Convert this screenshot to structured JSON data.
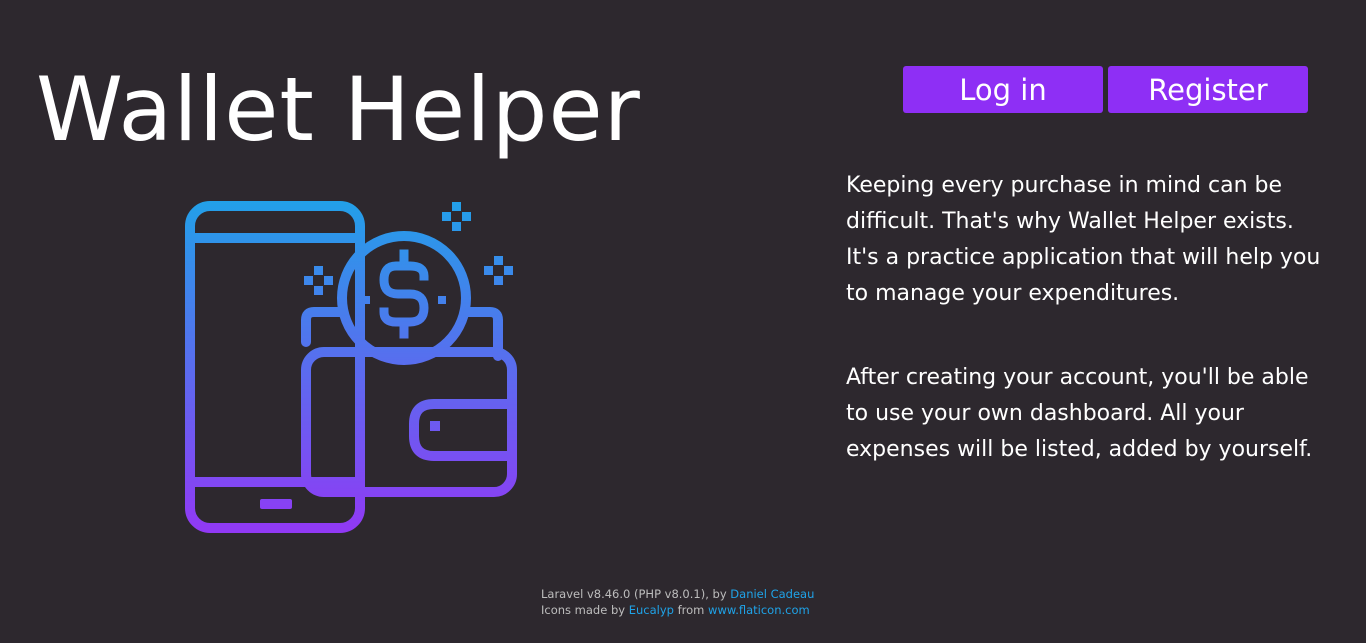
{
  "app": {
    "title": "Wallet Helper"
  },
  "nav": {
    "login_label": "Log in",
    "register_label": "Register"
  },
  "illustration": {
    "icon": "wallet-phone-dollar-icon",
    "gradient_top": "#1fa3e8",
    "gradient_bottom": "#9535f5"
  },
  "description": {
    "paragraph_1": "Keeping every purchase in mind can be difficult. That's why Wallet Helper exists. It's a practice application that will help you to manage your expenditures.",
    "paragraph_2": "After creating your account, you'll be able to use your own dashboard. All your expenses will be listed, added by yourself."
  },
  "footer": {
    "framework_text": "Laravel v8.46.0 (PHP v8.0.1), by ",
    "author_link": "Daniel Cadeau",
    "icons_text": "Icons made by ",
    "icons_author_link": "Eucalyp",
    "from_text": " from ",
    "site_link": "www.flaticon.com"
  },
  "colors": {
    "background": "#2d282e",
    "accent": "#8e2ff5",
    "link": "#1fa3e8",
    "text": "#ffffff",
    "muted_text": "#bdbdbd"
  }
}
